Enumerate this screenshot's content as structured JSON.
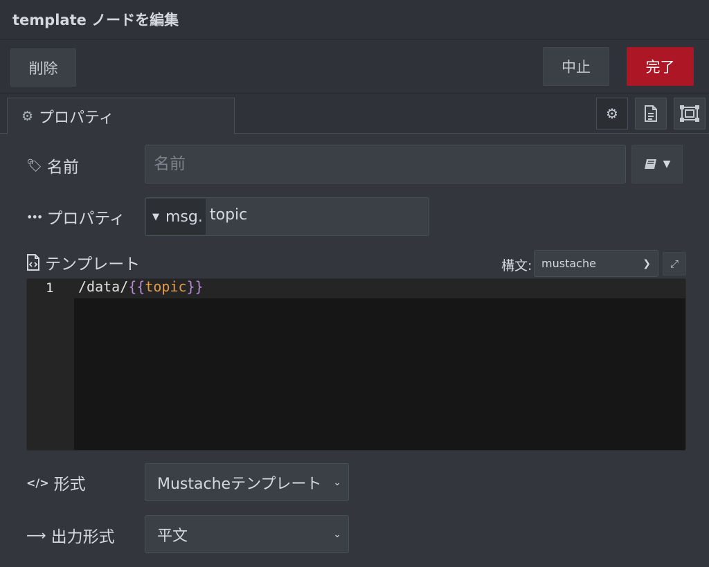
{
  "dialog": {
    "title": "template ノードを編集"
  },
  "toolbar": {
    "delete_label": "削除",
    "cancel_label": "中止",
    "done_label": "完了",
    "done_color": "#ad1625"
  },
  "tabs": {
    "properties_label": "プロパティ"
  },
  "form": {
    "name": {
      "label": "名前",
      "placeholder": "名前",
      "value": ""
    },
    "property": {
      "label": "プロパティ",
      "type_prefix": "msg.",
      "value": "topic"
    },
    "template": {
      "label": "テンプレート",
      "syntax_label": "構文:",
      "syntax_value": "mustache",
      "line_number": "1",
      "code": {
        "prefix": "/data/",
        "open_braces": "{{",
        "variable": "topic",
        "close_braces": "}}"
      }
    },
    "format": {
      "label": "形式",
      "value": "Mustacheテンプレート"
    },
    "output": {
      "label": "出力形式",
      "value": "平文"
    }
  },
  "icons": {
    "tab": "gear-icon",
    "name": "tag-icon",
    "property": "ellipsis-icon",
    "template": "file-code-icon",
    "format": "code-icon",
    "output": "arrow-right-icon",
    "library": "book-icon"
  }
}
